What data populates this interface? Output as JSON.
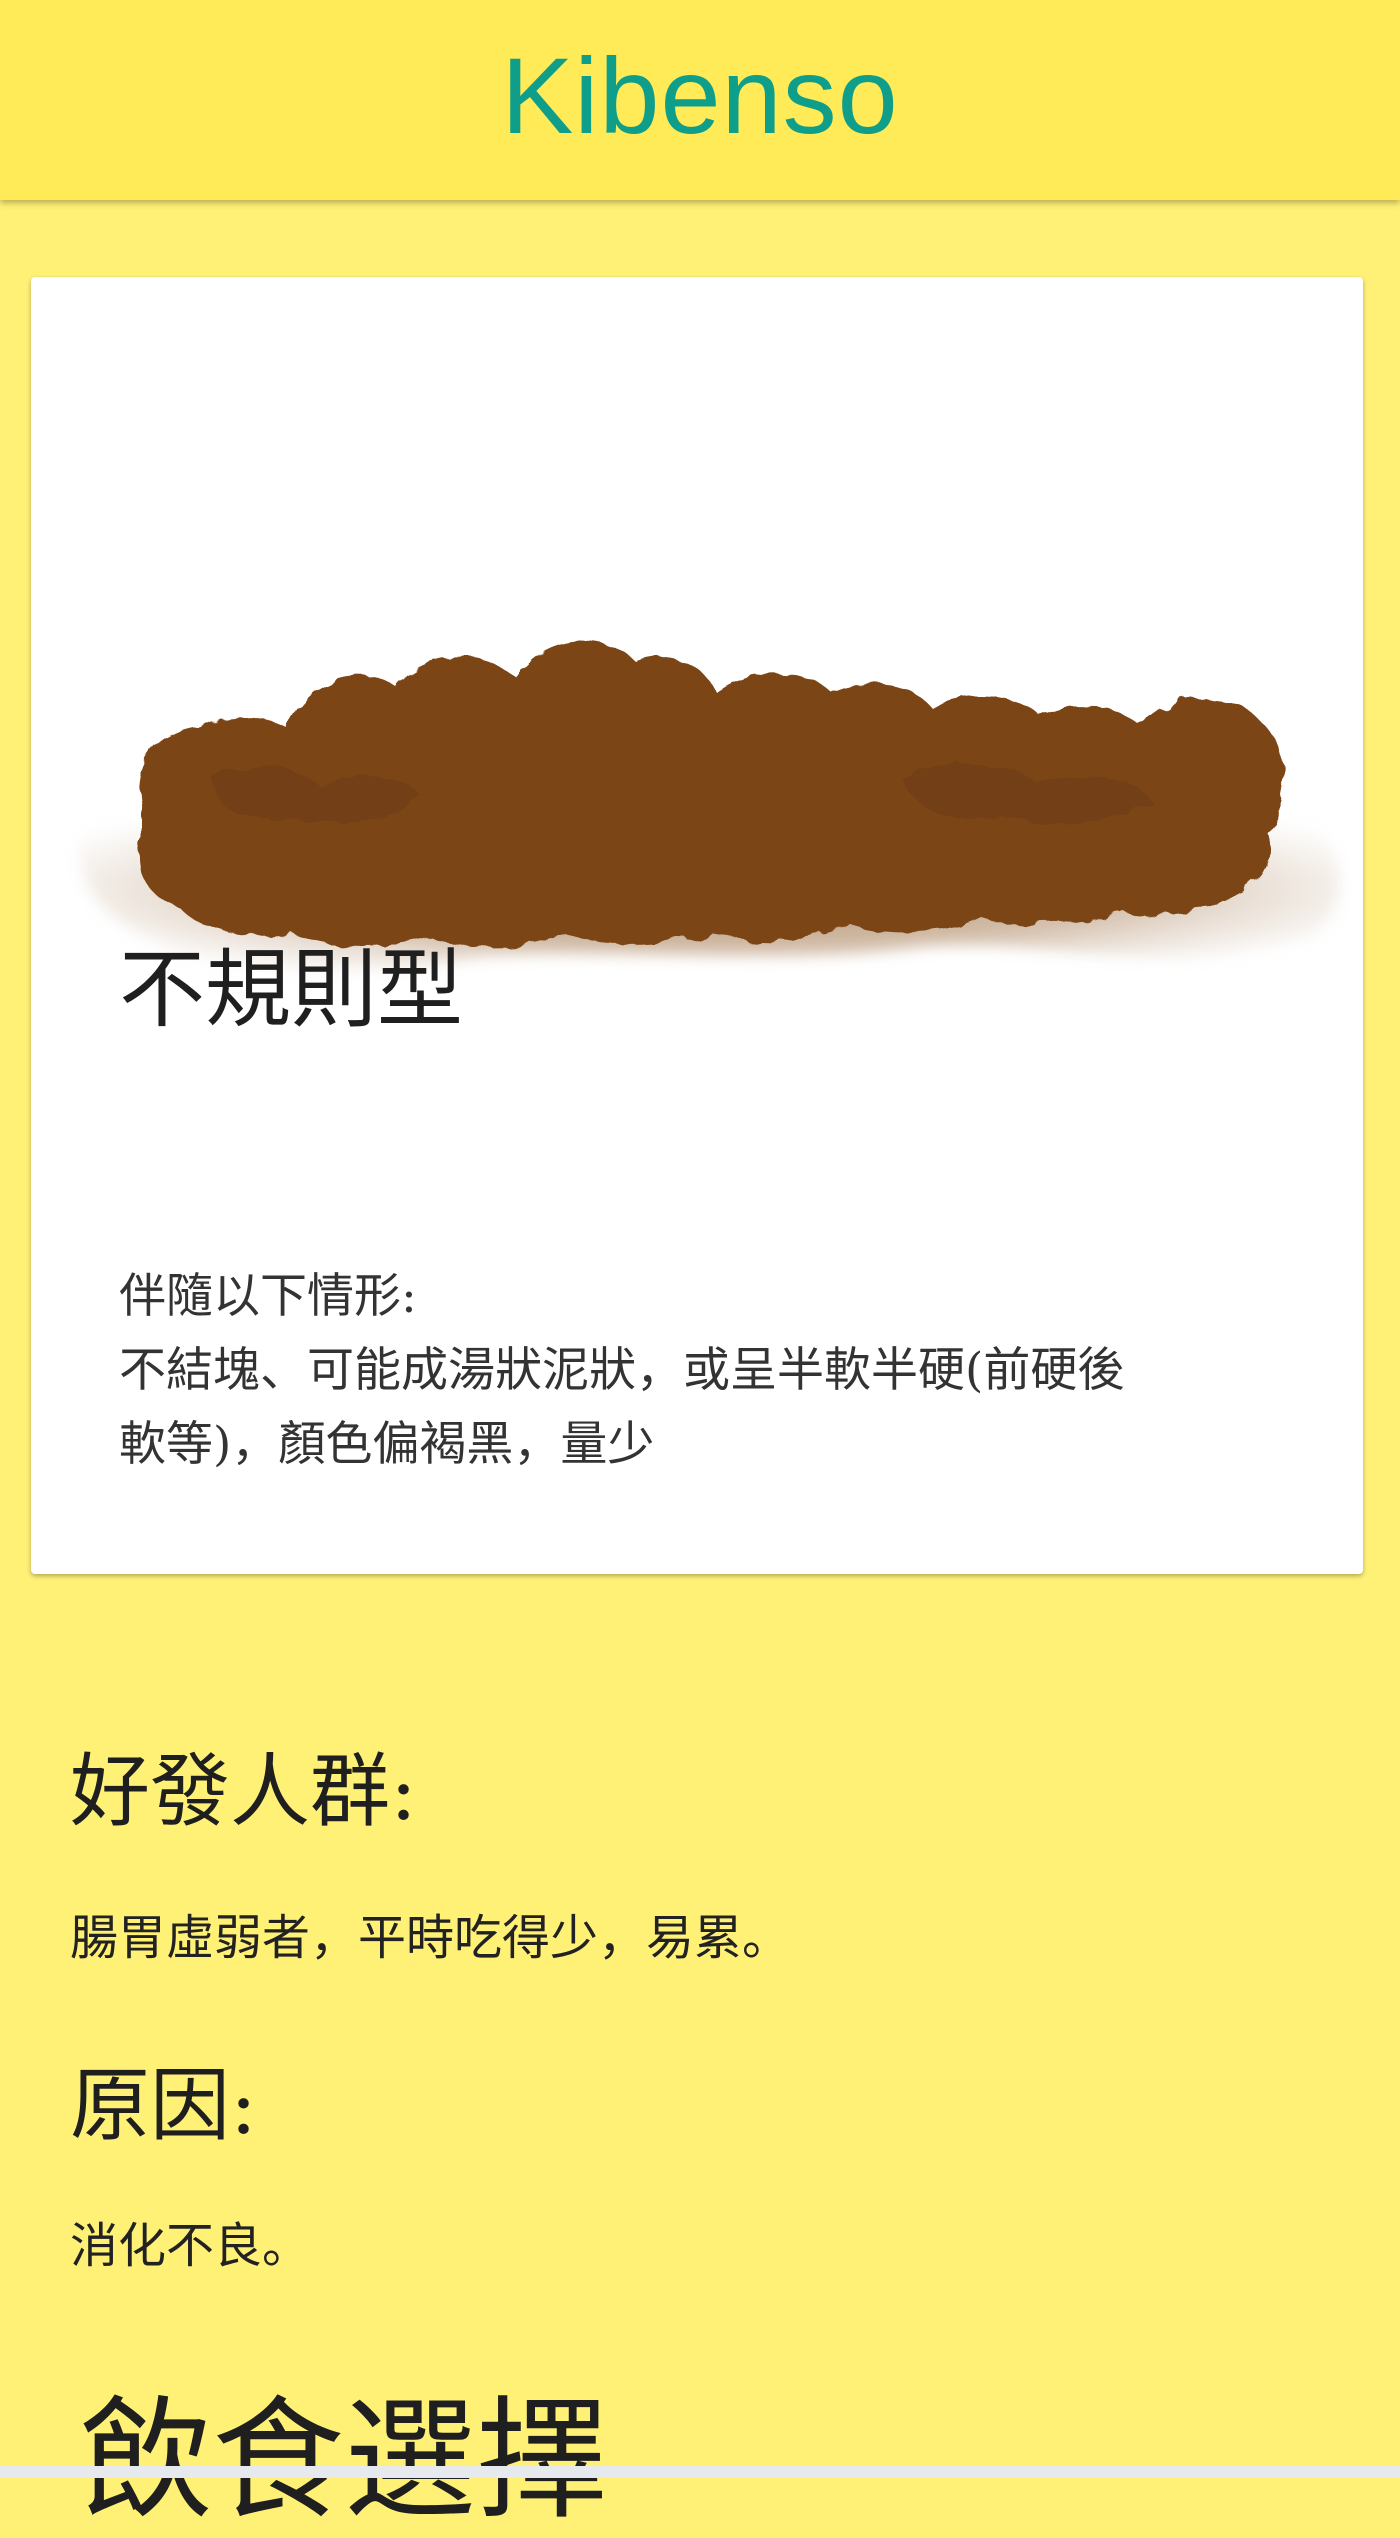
{
  "app": {
    "title": "Kibenso"
  },
  "card": {
    "image_icon": "irregular-stool-illustration",
    "title": "不規則型",
    "description_intro": "伴隨以下情形:",
    "description_line1": "不結塊、可能成湯狀泥狀，或呈半軟半硬(前硬後",
    "description_line2": "軟等)，顏色偏褐黑，量少"
  },
  "sections": [
    {
      "heading": "好發人群:",
      "body": "腸胃虛弱者，平時吃得少，易累。"
    },
    {
      "heading": "原因:",
      "body": "消化不良。"
    }
  ],
  "next_section": {
    "heading": "飲食選擇"
  },
  "colors": {
    "page_background": "#fff176",
    "app_bar": "#ffeb57",
    "title_accent": "#0e9e8a",
    "stool_brown": "#7b4517"
  }
}
